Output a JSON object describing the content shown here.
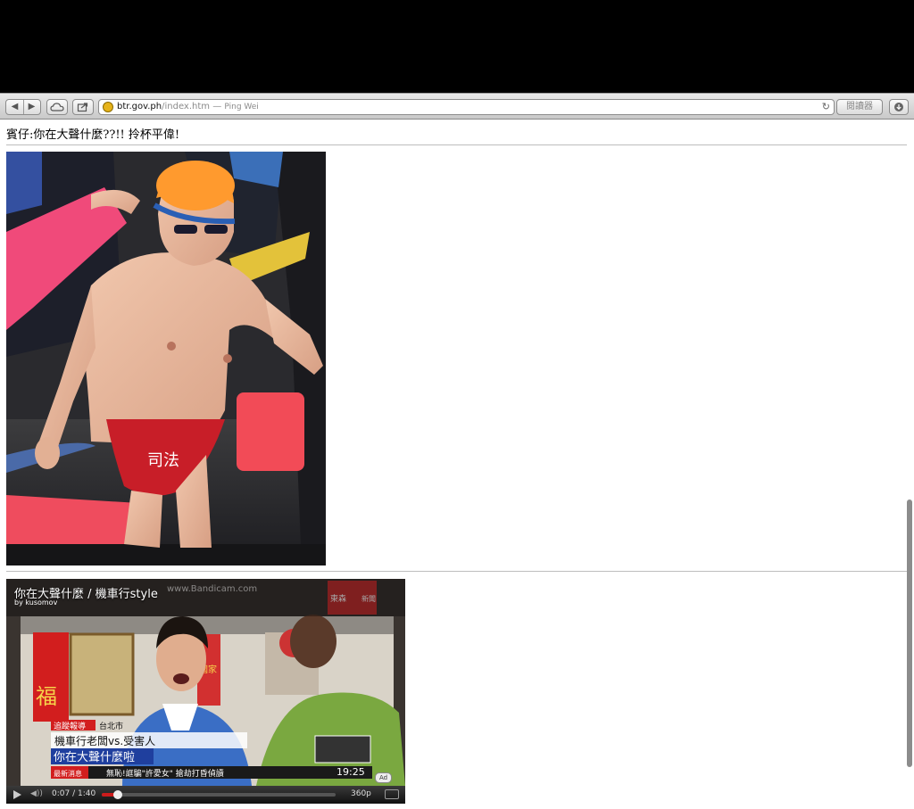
{
  "browser": {
    "url_domain": "btr.gov.ph",
    "url_path": "/index.htm",
    "url_separator": " — ",
    "page_title": "Ping Wei",
    "reader_label": "閱讀器"
  },
  "page": {
    "heading": "賓仔:你在大聲什麼??!! 拎杯平偉!",
    "photo_caption": "司法",
    "video": {
      "title": "你在大聲什麼 / 機車行style",
      "byline": "by kusomov",
      "watermark": "www.Bandicam.com",
      "news_channel": "東森",
      "news_logo": "新聞",
      "tag_breaking": "追蹤報導",
      "tag_location": "台北市",
      "headline_line1": "機車行老闆vs.受害人",
      "headline_line2": "你在大聲什麼啦",
      "ticker_tag": "最新消息",
      "ticker_text": "無恥!誆騙\"許愛女\" 搶劫打昏偵讀",
      "news_time": "19:25",
      "wall_char": "福",
      "side_char": "國家",
      "ad_label": "Ad",
      "time_display": "0:07 / 1:40",
      "progress": 0.07,
      "quality": "360p"
    }
  },
  "colors": {
    "cap": "#ff9a2e",
    "trunks": "#c81e28",
    "float": "#f04a5f",
    "news_red": "#d21e1e",
    "news_blue": "#1f3f9e",
    "progress": "#cc1b1b"
  }
}
